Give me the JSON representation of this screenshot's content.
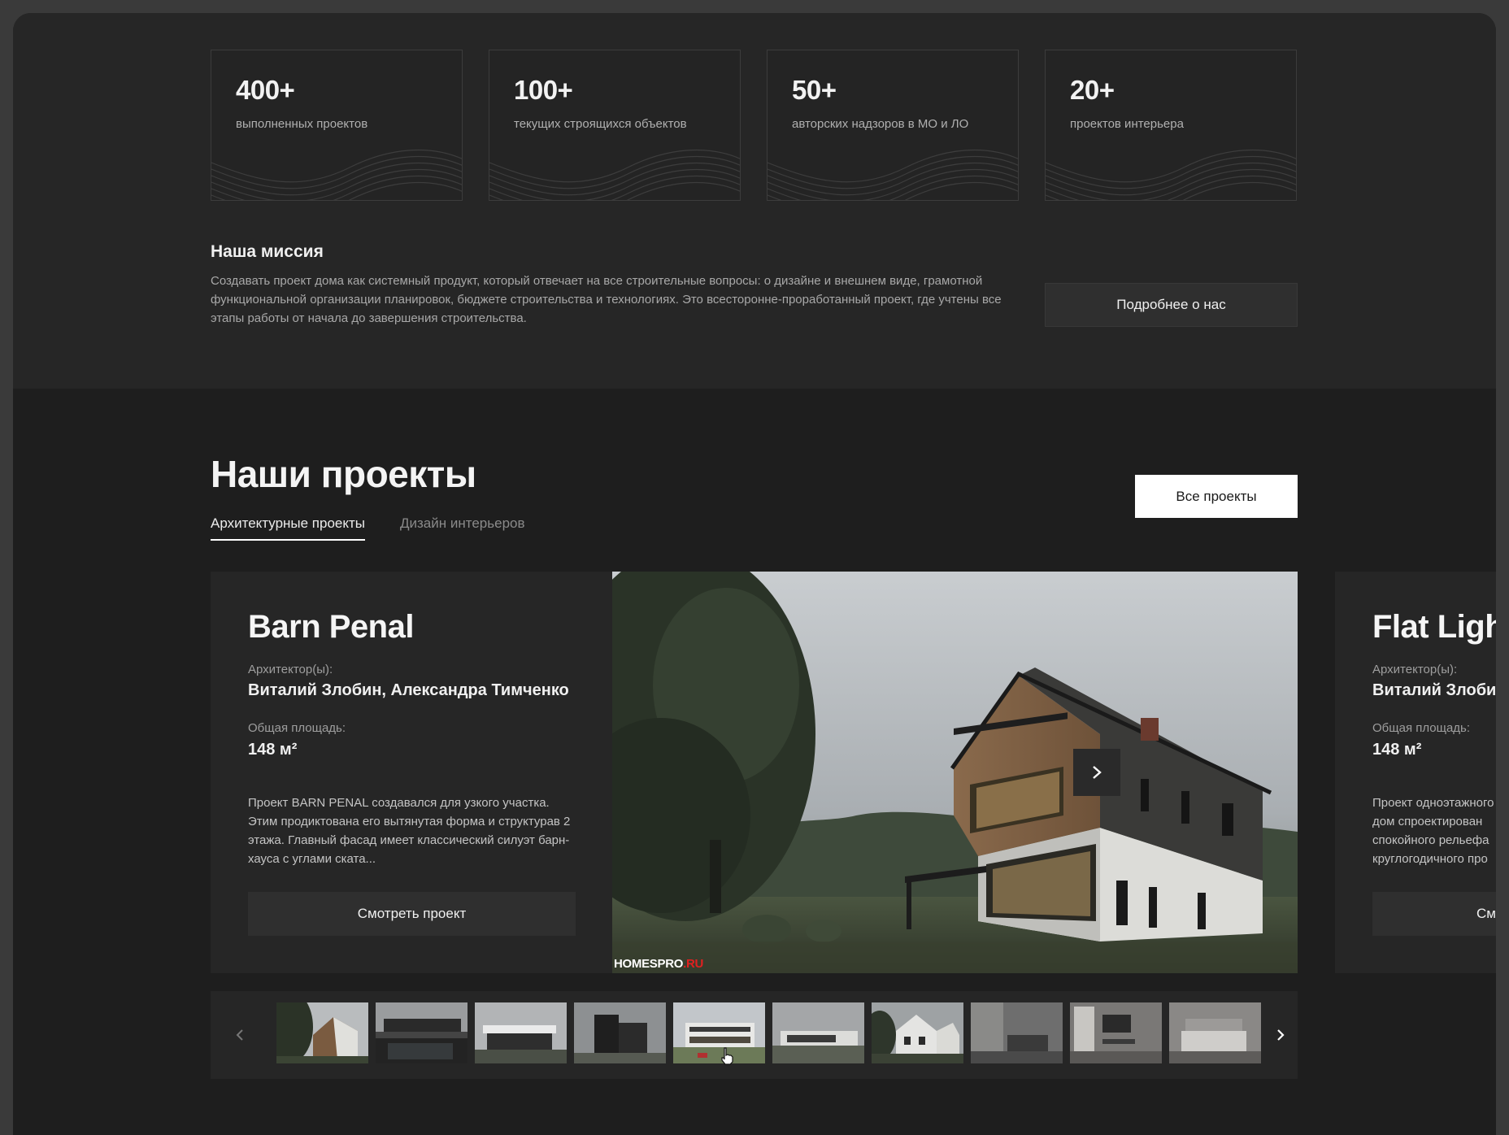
{
  "stats": [
    {
      "value": "400+",
      "label": "выполненных проектов"
    },
    {
      "value": "100+",
      "label": "текущих строящихся объектов"
    },
    {
      "value": "50+",
      "label": "авторских надзоров в МО и ЛО"
    },
    {
      "value": "20+",
      "label": "проектов интерьера"
    }
  ],
  "mission": {
    "title": "Наша миссия",
    "text": "Создавать проект дома как системный продукт, который отвечает на все строительные вопросы: о дизайне и внешнем виде, грамотной функциональной организации планировок, бюджете строительства и технологиях. Это всесторонне-проработанный проект, где учтены все этапы работы от начала до завершения строительства.",
    "button": "Подробнее о нас"
  },
  "projects": {
    "title": "Наши проекты",
    "all_button": "Все проекты",
    "tabs": [
      {
        "label": "Архитектурные проекты",
        "active": true
      },
      {
        "label": "Дизайн интерьеров",
        "active": false
      }
    ]
  },
  "cards": [
    {
      "title": "Barn Penal",
      "architect_label": "Архитектор(ы):",
      "architect": "Виталий Злобин, Александра Тимченко",
      "area_label": "Общая площадь:",
      "area": "148 м²",
      "description": "Проект BARN PENAL создавался для узкого участка. Этим продиктована его вытянутая форма и структурав 2 этажа. Главный фасад имеет классический силуэт барн-хауса с углами ската...",
      "button": "Смотреть проект",
      "watermark_main": "HOMESPRO",
      "watermark_suffix": ".RU"
    },
    {
      "title": "Flat Light",
      "architect_label": "Архитектор(ы):",
      "architect": "Виталий Злобин",
      "area_label": "Общая площадь:",
      "area": "148 м²",
      "description_lines": [
        "Проект одноэтажного",
        "дом спроектирован",
        "спокойного рельефа",
        "круглогодичного про"
      ],
      "button": "Смотреть проект"
    }
  ],
  "thumbnails": [
    "house-barn",
    "house-pool",
    "house-modern",
    "house-dark-cubes",
    "house-white-two-story",
    "house-flat",
    "house-gable-cottage",
    "interior-kitchen-grey",
    "interior-dining",
    "interior-bedroom"
  ],
  "icons": {
    "next": "chevron-right-icon",
    "prev": "chevron-left-icon",
    "cursor": "hand-pointer-icon"
  },
  "colors": {
    "page_bg": "#262626",
    "section_bg": "#1e1e1e",
    "button_bg": "#2f2f2f",
    "accent_red": "#e02020"
  }
}
